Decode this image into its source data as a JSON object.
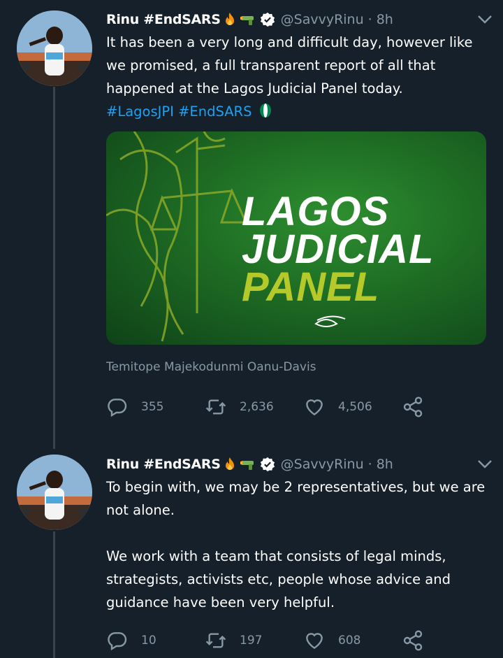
{
  "tweets": [
    {
      "display_name": "Rinu #EndSARS",
      "handle": "@SavvyRinu",
      "separator": "·",
      "time": "8h",
      "text_lines": [
        "It has been a very long and difficult day, however like we promised, a full transparent report of all that happened at the Lagos Judicial Panel today."
      ],
      "hashtags": "#LagosJPI #EndSARS",
      "media": {
        "line1": "LAGOS",
        "line2": "JUDICIAL",
        "line3": "PANEL"
      },
      "media_caption": "Temitope Majekodunmi Oanu-Davis",
      "replies": "355",
      "retweets": "2,636",
      "likes": "4,506"
    },
    {
      "display_name": "Rinu #EndSARS",
      "handle": "@SavvyRinu",
      "separator": "·",
      "time": "8h",
      "para1": "To begin with, we may be 2 representatives, but we are not alone.",
      "para2": "We work with a team that consists of legal minds, strategists, activists etc, people whose advice and guidance have been very helpful.",
      "replies": "10",
      "retweets": "197",
      "likes": "608"
    }
  ],
  "icons": {
    "reply": "reply-icon",
    "retweet": "retweet-icon",
    "like": "heart-icon",
    "share": "share-icon",
    "verified": "verified-badge-icon",
    "caret": "chevron-down-icon",
    "fire": "fire-emoji",
    "water_gun": "water-pistol-emoji",
    "flag": "nigeria-flag-emoji"
  },
  "colors": {
    "background": "#15202b",
    "secondary_text": "#8899a6",
    "link": "#1da1f2",
    "panel_green": "#1f6f25",
    "panel_accent": "#b6c92a"
  }
}
